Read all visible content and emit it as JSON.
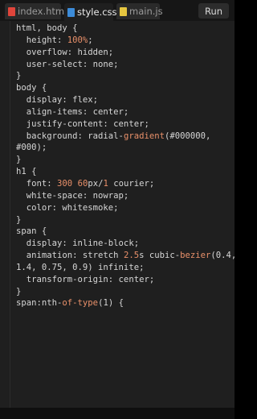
{
  "tabs": [
    {
      "label": "index.html",
      "icon": "html-file-icon",
      "active": false
    },
    {
      "label": "style.css",
      "icon": "css-file-icon",
      "active": true
    },
    {
      "label": "main.js",
      "icon": "js-file-icon",
      "active": false
    }
  ],
  "run_label": "Run",
  "colors": {
    "background": "#1f1f1f",
    "text": "#d6d6d6",
    "number_accent": "#e9906a"
  },
  "code_lines": [
    [
      [
        "html, body {",
        "t"
      ]
    ],
    [
      [
        "  height: ",
        "t"
      ],
      [
        "100%",
        "n"
      ],
      [
        ";",
        "t"
      ]
    ],
    [
      [
        "  overflow: hidden;",
        "t"
      ]
    ],
    [
      [
        "  user-select: none;",
        "t"
      ]
    ],
    [
      [
        "}",
        "t"
      ]
    ],
    [
      [
        "body {",
        "t"
      ]
    ],
    [
      [
        "  display: flex;",
        "t"
      ]
    ],
    [
      [
        "  align-items: center;",
        "t"
      ]
    ],
    [
      [
        "  justify-content: center;",
        "t"
      ]
    ],
    [
      [
        "  background: radial-",
        "t"
      ],
      [
        "gradient",
        "f"
      ],
      [
        "(#000000,",
        "t"
      ]
    ],
    [
      [
        "#000);",
        "t"
      ]
    ],
    [
      [
        "}",
        "t"
      ]
    ],
    [
      [
        "h1 {",
        "t"
      ]
    ],
    [
      [
        "  font: ",
        "t"
      ],
      [
        "300",
        "n"
      ],
      [
        " ",
        "t"
      ],
      [
        "60",
        "n"
      ],
      [
        "px/",
        "t"
      ],
      [
        "1",
        "n"
      ],
      [
        " courier;",
        "t"
      ]
    ],
    [
      [
        "  white-space: nowrap;",
        "t"
      ]
    ],
    [
      [
        "  color: whitesmoke;",
        "t"
      ]
    ],
    [
      [
        "}",
        "t"
      ]
    ],
    [
      [
        "span {",
        "t"
      ]
    ],
    [
      [
        "  display: inline-block;",
        "t"
      ]
    ],
    [
      [
        "  animation: stretch ",
        "t"
      ],
      [
        "2.5",
        "n"
      ],
      [
        "s cubic-",
        "t"
      ],
      [
        "bezier",
        "f"
      ],
      [
        "(0.4,",
        "t"
      ]
    ],
    [
      [
        "1.4, 0.75, 0.9) infinite;",
        "t"
      ]
    ],
    [
      [
        "  transform-origin: center;",
        "t"
      ]
    ],
    [
      [
        "}",
        "t"
      ]
    ],
    [
      [
        "span:nth-",
        "t"
      ],
      [
        "of-type",
        "f"
      ],
      [
        "(1) {",
        "t"
      ]
    ]
  ]
}
